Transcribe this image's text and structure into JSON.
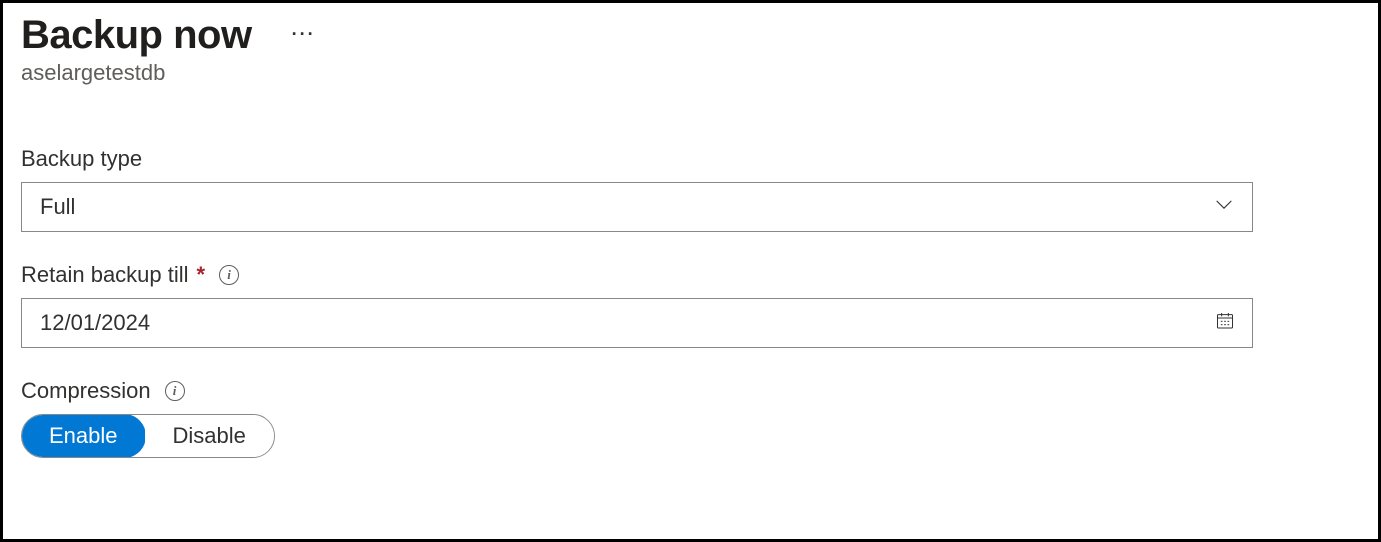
{
  "header": {
    "title": "Backup now",
    "subtitle": "aselargetestdb"
  },
  "fields": {
    "backup_type": {
      "label": "Backup type",
      "value": "Full"
    },
    "retain_till": {
      "label": "Retain backup till",
      "value": "12/01/2024",
      "required": "*"
    },
    "compression": {
      "label": "Compression",
      "enable_label": "Enable",
      "disable_label": "Disable"
    }
  }
}
